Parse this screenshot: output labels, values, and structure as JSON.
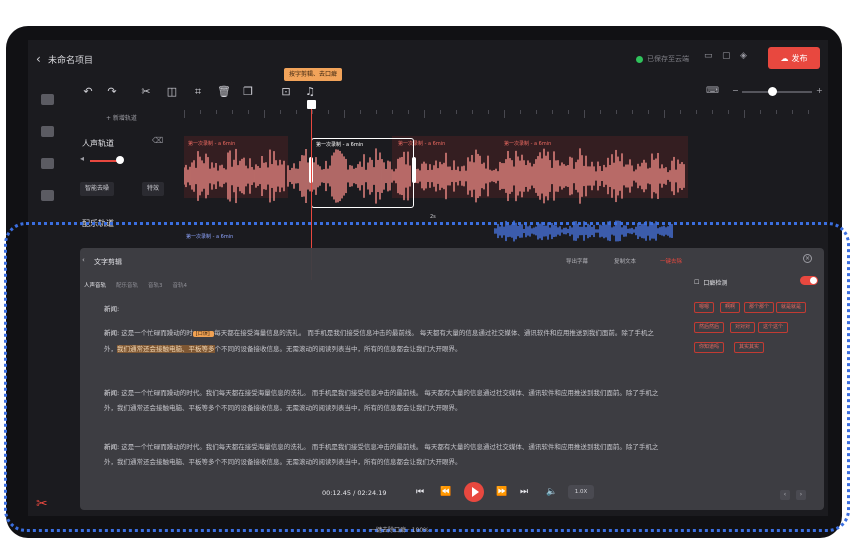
{
  "app": {
    "project_name": "未命名项目",
    "save_status": "已保存至云端",
    "publish_label": "发布",
    "add_track_label": "+ 新增轨道",
    "tooltip": "按字剪辑、去口癖"
  },
  "tracks": {
    "vocal_title": "人声轨道",
    "dub_title": "配乐轨道",
    "smart_denoise": "智能去噪",
    "effects": "特效"
  },
  "clips": {
    "clip_label": "第一次录制 - a 6min",
    "selected_label": "第一次录制 - a 6min",
    "selected_duration": "2s",
    "bottom_clip_label": "第一次录制 - a 6min"
  },
  "panel": {
    "title": "文字剪辑",
    "export_subtitle": "导出字幕",
    "copy_text": "复制文本",
    "deverbal": "一键去除",
    "tabs": [
      "人声音轨",
      "配乐音轨",
      "音轨3",
      "音轨4"
    ],
    "speaker_label": "新闻:",
    "paragraphs": [
      {
        "speaker": "新闻:",
        "before": "这是一个忙碌而躁动的时",
        "tag": "[口误] ",
        "after": "每天都在接受海量信息的洗礼。 而手机是我们接受信息冲击的最前线。 每天都有大量的信息通过社交媒体、通讯软件和应用推送到我们面前。除了手机之外，",
        "highlight": "我们通常还会接触电脑、平板等多",
        "end": "个不同的设备接收信息。无需滚动的阅读列表当中，所有的信息都会让我们大开眼界。"
      },
      {
        "speaker": "新闻:",
        "text": "这是一个忙碌而躁动的时代。我们每天都在接受海量信息的洗礼。 而手机是我们接受信息冲击的最前线。 每天都有大量的信息通过社交媒体、通讯软件和应用推送到我们面前。除了手机之外，我们通常还会接触电脑、平板等多个不同的设备接收信息。无需滚动的阅读列表当中，所有的信息都会让我们大开眼界。"
      },
      {
        "speaker": "新闻:",
        "text": "这是一个忙碌而躁动的时代。我们每天都在接受海量信息的洗礼。 而手机是我们接受信息冲击的最前线。 每天都有大量的信息通过社交媒体、通讯软件和应用推送到我们面前。除了手机之外，我们通常还会接触电脑、平板等多个不同的设备接收信息。无需滚动的阅读列表当中，所有的信息都会让我们大开眼界。"
      }
    ],
    "right": {
      "title": "口癖检测",
      "chips": [
        "嗯嗯",
        "啊啊",
        "那个那个",
        "就是就是",
        "然后然后",
        "对对对",
        "这个这个",
        "你知道吗",
        "其实其实"
      ]
    },
    "player": {
      "time": "00:12.45 / 02:24.19",
      "speed": "1.0X"
    }
  },
  "bottom_hint": "一键去除口癖 · 100%",
  "colors": {
    "accent": "#e8483f",
    "waveform": "#f08a86",
    "highlight": "#f0a152",
    "selection_border": "#3b6fe0"
  }
}
